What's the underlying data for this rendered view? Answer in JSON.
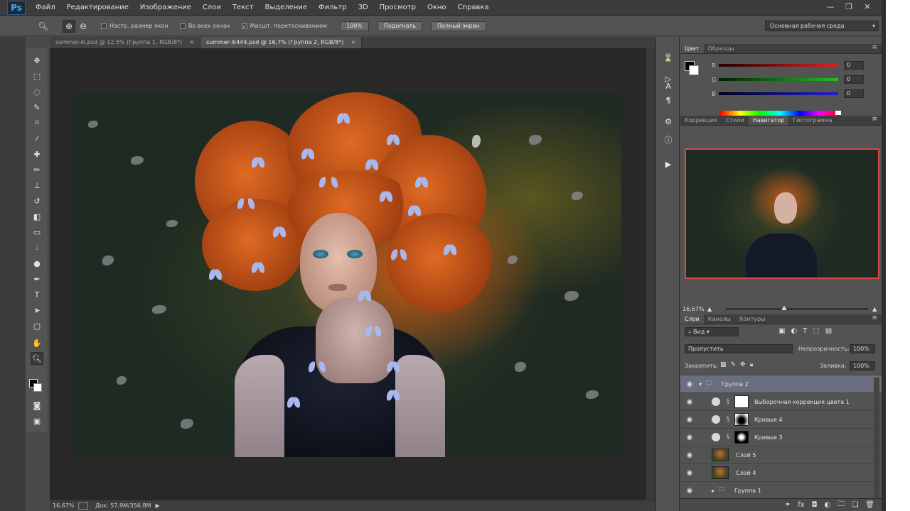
{
  "menubar": {
    "logo": "Ps",
    "items": [
      "Файл",
      "Редактирование",
      "Изображение",
      "Слои",
      "Текст",
      "Выделение",
      "Фильтр",
      "3D",
      "Просмотр",
      "Окно",
      "Справка"
    ],
    "minimize": "—",
    "restore": "❐",
    "close": "✕"
  },
  "options": {
    "zoom_icon": "zoom-tool-icon",
    "check1": "Настр. размер окон",
    "check2": "Во всех окнах",
    "check3": "Масшт. перетаскиванием",
    "btn_100": "100%",
    "btn_fit": "Подогнать",
    "btn_fill": "Полный экран",
    "workspace": "Основная рабочая среда"
  },
  "doctabs": [
    {
      "label": "summer-ik.psd @ 12,5% (Группа 1, RGB/8*)",
      "close": "×"
    },
    {
      "label": "summer-ik444.psd @ 16,7% (Группа 2, RGB/8*)",
      "close": "×"
    }
  ],
  "status": {
    "zoom": "16,67%",
    "doc": "Док: 57,9M/356,8M",
    "arrow": "▶"
  },
  "color_panel": {
    "tabs": [
      "Цвет",
      "Образцы"
    ],
    "r_label": "R",
    "r_value": "0",
    "g_label": "G",
    "g_value": "0",
    "b_label": "B",
    "b_value": "0",
    "colors": {
      "red": "#e02020",
      "green": "#20c020",
      "blue": "#2020d0"
    }
  },
  "nav_panel": {
    "tabs": [
      "Коррекция",
      "Стили",
      "Навигатор",
      "Гистограмма"
    ],
    "zoom": "16,67%"
  },
  "layers_panel": {
    "tabs": [
      "Слои",
      "Каналы",
      "Контуры"
    ],
    "filter": "Вид",
    "blend_mode": "Пропустить",
    "opacity_label": "Непрозрачность:",
    "opacity": "100%",
    "lock_label": "Закрепить:",
    "fill_label": "Заливка:",
    "fill": "100%",
    "layers": [
      {
        "name": "Группа 2",
        "type": "group",
        "selected": true
      },
      {
        "name": "Выборочная коррекция цвета 1",
        "type": "adjustment"
      },
      {
        "name": "Кривые 4",
        "type": "adjustment"
      },
      {
        "name": "Кривые 3",
        "type": "adjustment"
      },
      {
        "name": "Слой 5",
        "type": "pixel"
      },
      {
        "name": "Слой 4",
        "type": "pixel"
      },
      {
        "name": "Группа 1",
        "type": "group"
      }
    ]
  }
}
